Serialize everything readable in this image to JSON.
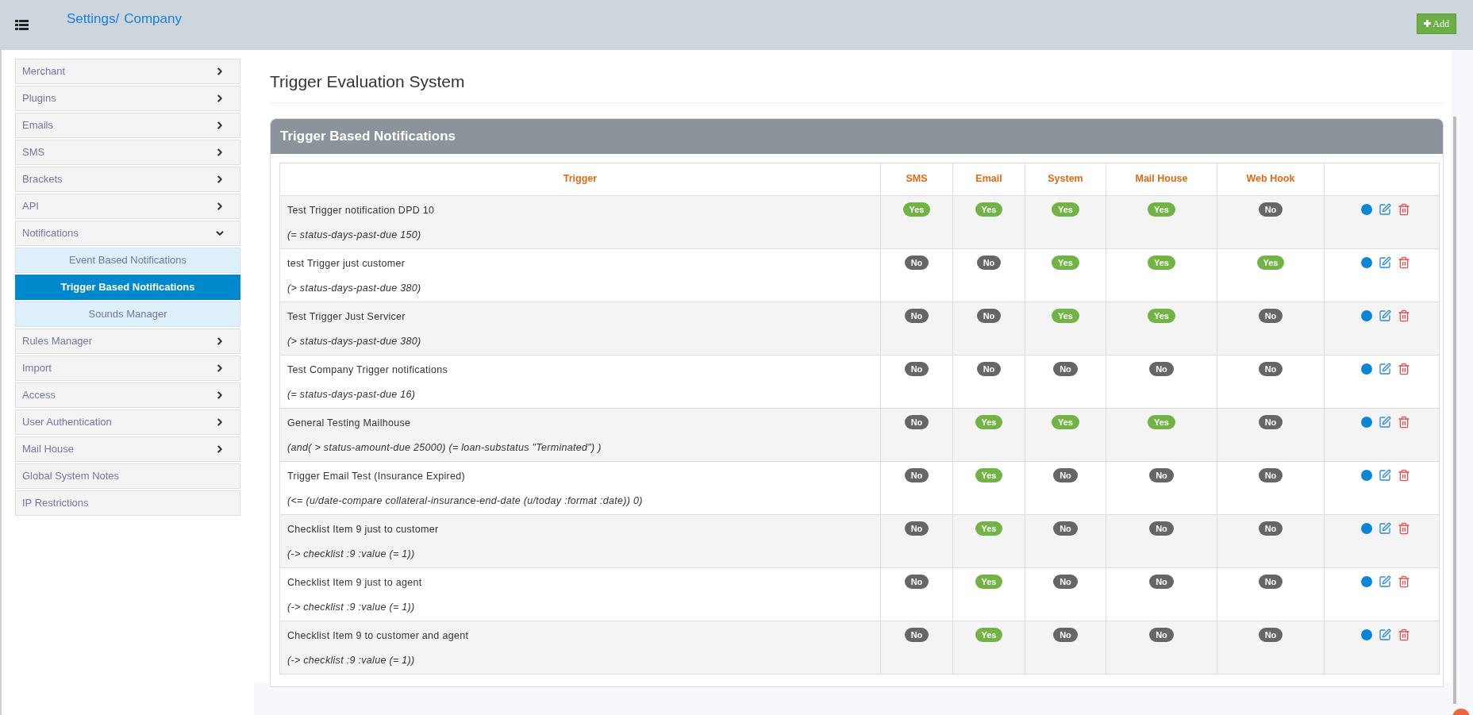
{
  "header": {
    "breadcrumb": [
      {
        "label": "Settings/"
      },
      {
        "label": "Company"
      }
    ],
    "add_button": "Add"
  },
  "sidebar": {
    "items": [
      {
        "label": "Merchant",
        "kind": "group",
        "expanded": false
      },
      {
        "label": "Plugins",
        "kind": "group",
        "expanded": false
      },
      {
        "label": "Emails",
        "kind": "group",
        "expanded": false
      },
      {
        "label": "SMS",
        "kind": "group",
        "expanded": false
      },
      {
        "label": "Brackets",
        "kind": "group",
        "expanded": false
      },
      {
        "label": "API",
        "kind": "group",
        "expanded": false
      },
      {
        "label": "Notifications",
        "kind": "group",
        "expanded": true,
        "children": [
          {
            "label": "Event Based Notifications",
            "selected": false
          },
          {
            "label": "Trigger Based Notifications",
            "selected": true
          },
          {
            "label": "Sounds Manager",
            "selected": false
          }
        ]
      },
      {
        "label": "Rules Manager",
        "kind": "group",
        "expanded": false
      },
      {
        "label": "Import",
        "kind": "group",
        "expanded": false
      },
      {
        "label": "Access",
        "kind": "group",
        "expanded": false
      },
      {
        "label": "User Authentication",
        "kind": "group",
        "expanded": false
      },
      {
        "label": "Mail House",
        "kind": "group",
        "expanded": false
      },
      {
        "label": "Global System Notes",
        "kind": "link"
      },
      {
        "label": "IP Restrictions",
        "kind": "link"
      }
    ]
  },
  "page_title": "Trigger Evaluation System",
  "panel": {
    "title": "Trigger Based Notifications",
    "table": {
      "columns": [
        "Trigger",
        "SMS",
        "Email",
        "System",
        "Mail House",
        "Web Hook"
      ],
      "rows": [
        {
          "name": "Test Trigger notification DPD 10",
          "expression": "(= status-days-past-due 150)",
          "flags": [
            {
              "label": "Yes",
              "on": true
            },
            {
              "label": "Yes",
              "on": true
            },
            {
              "label": "Yes",
              "on": true
            },
            {
              "label": "Yes",
              "on": true
            },
            {
              "label": "No",
              "on": false
            }
          ]
        },
        {
          "name": "test Trigger just customer",
          "expression": "(> status-days-past-due 380)",
          "flags": [
            {
              "label": "No",
              "on": false
            },
            {
              "label": "No",
              "on": false
            },
            {
              "label": "Yes",
              "on": true
            },
            {
              "label": "Yes",
              "on": true
            },
            {
              "label": "Yes",
              "on": true
            }
          ]
        },
        {
          "name": "Test Trigger Just Servicer",
          "expression": "(> status-days-past-due 380)",
          "flags": [
            {
              "label": "No",
              "on": false
            },
            {
              "label": "No",
              "on": false
            },
            {
              "label": "Yes",
              "on": true
            },
            {
              "label": "Yes",
              "on": true
            },
            {
              "label": "No",
              "on": false
            }
          ]
        },
        {
          "name": "Test Company Trigger notifications",
          "expression": "(= status-days-past-due 16)",
          "flags": [
            {
              "label": "No",
              "on": false
            },
            {
              "label": "No",
              "on": false
            },
            {
              "label": "No",
              "on": false
            },
            {
              "label": "No",
              "on": false
            },
            {
              "label": "No",
              "on": false
            }
          ]
        },
        {
          "name": "General Testing Mailhouse",
          "expression": "(and( > status-amount-due 25000) (= loan-substatus \"Terminated\") )",
          "flags": [
            {
              "label": "No",
              "on": false
            },
            {
              "label": "Yes",
              "on": true
            },
            {
              "label": "Yes",
              "on": true
            },
            {
              "label": "Yes",
              "on": true
            },
            {
              "label": "No",
              "on": false
            }
          ]
        },
        {
          "name": "Trigger Email Test (Insurance Expired)",
          "expression": "(<= (u/date-compare collateral-insurance-end-date (u/today :format :date)) 0)",
          "flags": [
            {
              "label": "No",
              "on": false
            },
            {
              "label": "Yes",
              "on": true
            },
            {
              "label": "No",
              "on": false
            },
            {
              "label": "No",
              "on": false
            },
            {
              "label": "No",
              "on": false
            }
          ]
        },
        {
          "name": "Checklist Item 9 just to customer",
          "expression": "(-> checklist :9 :value (= 1))",
          "flags": [
            {
              "label": "No",
              "on": false
            },
            {
              "label": "Yes",
              "on": true
            },
            {
              "label": "No",
              "on": false
            },
            {
              "label": "No",
              "on": false
            },
            {
              "label": "No",
              "on": false
            }
          ]
        },
        {
          "name": "Checklist Item 9 just to agent",
          "expression": "(-> checklist :9 :value (= 1))",
          "flags": [
            {
              "label": "No",
              "on": false
            },
            {
              "label": "Yes",
              "on": true
            },
            {
              "label": "No",
              "on": false
            },
            {
              "label": "No",
              "on": false
            },
            {
              "label": "No",
              "on": false
            }
          ]
        },
        {
          "name": "Checklist Item 9 to customer and agent",
          "expression": "(-> checklist :9 :value (= 1))",
          "flags": [
            {
              "label": "No",
              "on": false
            },
            {
              "label": "Yes",
              "on": true
            },
            {
              "label": "No",
              "on": false
            },
            {
              "label": "No",
              "on": false
            },
            {
              "label": "No",
              "on": false
            }
          ]
        }
      ]
    }
  }
}
